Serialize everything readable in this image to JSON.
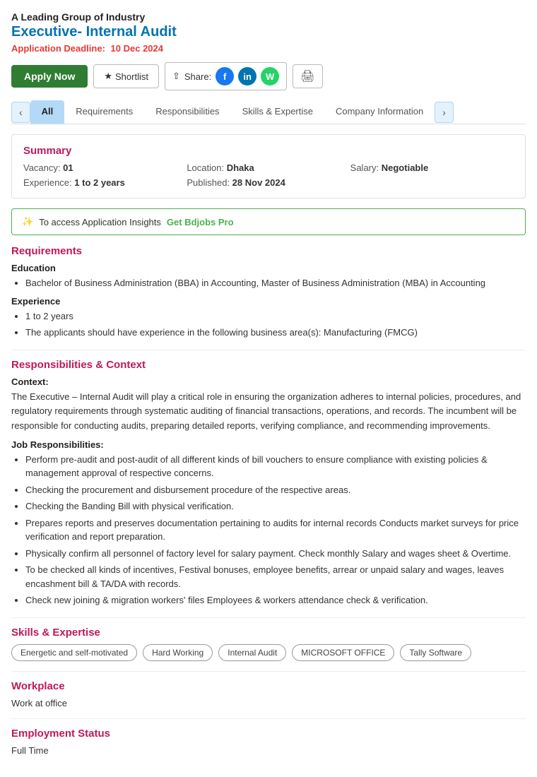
{
  "header": {
    "company": "A Leading Group of Industry",
    "job_title": "Executive- Internal Audit",
    "deadline_label": "Application Deadline:",
    "deadline_value": "10 Dec 2024"
  },
  "actions": {
    "apply_label": "Apply Now",
    "shortlist_label": "Shortlist",
    "share_label": "Share:",
    "print_icon": "🖨"
  },
  "tabs": [
    {
      "label": "All",
      "active": true
    },
    {
      "label": "Requirements",
      "active": false
    },
    {
      "label": "Responsibilities",
      "active": false
    },
    {
      "label": "Skills & Expertise",
      "active": false
    },
    {
      "label": "Company Information",
      "active": false
    }
  ],
  "summary": {
    "title": "Summary",
    "vacancy_label": "Vacancy:",
    "vacancy_value": "01",
    "location_label": "Location:",
    "location_value": "Dhaka",
    "salary_label": "Salary:",
    "salary_value": "Negotiable",
    "experience_label": "Experience:",
    "experience_value": "1 to 2 years",
    "published_label": "Published:",
    "published_value": "28 Nov 2024"
  },
  "insights": {
    "text": "To access Application Insights",
    "link_label": "Get Bdjobs Pro"
  },
  "requirements": {
    "title": "Requirements",
    "education_heading": "Education",
    "education_items": [
      "Bachelor of Business Administration (BBA) in Accounting, Master of Business Administration (MBA) in Accounting"
    ],
    "experience_heading": "Experience",
    "experience_items": [
      "1 to 2 years",
      "The applicants should have experience in the following business area(s): Manufacturing (FMCG)"
    ]
  },
  "responsibilities": {
    "title": "Responsibilities & Context",
    "context_heading": "Context:",
    "context_text": "The Executive – Internal Audit will play a critical role in ensuring the organization adheres to internal policies, procedures, and regulatory requirements through systematic auditing of financial transactions, operations, and records. The incumbent will be responsible for conducting audits, preparing detailed reports, verifying compliance, and recommending improvements.",
    "job_resp_heading": "Job Responsibilities:",
    "job_resp_items": [
      "Perform pre-audit and post-audit of all different kinds of bill vouchers to ensure compliance with existing policies & management approval of respective concerns.",
      "Checking the procurement and disbursement procedure of the respective areas.",
      "Checking the Banding Bill with physical verification.",
      "Prepares reports and preserves documentation pertaining to audits for internal records Conducts market surveys for price verification and report preparation.",
      "Physically confirm all personnel of factory level for salary payment. Check monthly Salary and wages sheet & Overtime.",
      "To be checked all kinds of incentives, Festival bonuses, employee benefits, arrear or unpaid salary and wages, leaves encashment bill & TA/DA with records.",
      "Check new joining & migration workers' files Employees & workers attendance check & verification."
    ]
  },
  "skills": {
    "title": "Skills & Expertise",
    "tags": [
      "Energetic and self-motivated",
      "Hard Working",
      "Internal Audit",
      "MICROSOFT OFFICE",
      "Tally Software"
    ]
  },
  "workplace": {
    "title": "Workplace",
    "value": "Work at office"
  },
  "employment": {
    "title": "Employment Status",
    "value": "Full Time"
  }
}
